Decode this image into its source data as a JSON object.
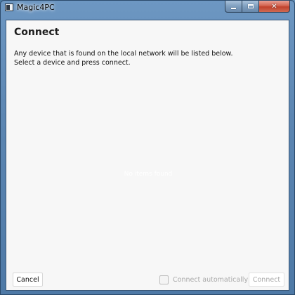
{
  "window": {
    "title": "Magic4PC",
    "app_icon": "app-window-icon",
    "controls": {
      "minimize_icon": "minimize-icon",
      "maximize_icon": "maximize-icon",
      "close_icon": "close-icon",
      "close_glyph": "✕"
    }
  },
  "dialog": {
    "heading": "Connect",
    "description_line1": "Any device that is found on the local network will be listed below.",
    "description_line2": "Select a device and press connect.",
    "empty_message": "No items found"
  },
  "footer": {
    "cancel_label": "Cancel",
    "auto_connect_label": "Connect automatically",
    "auto_connect_checked": false,
    "connect_label": "Connect",
    "connect_enabled": false
  },
  "colors": {
    "titlebar": "#5c86b2",
    "client_background": "#f7f7f7",
    "close_button": "#c0412c",
    "disabled_text": "#a9a9a9"
  }
}
